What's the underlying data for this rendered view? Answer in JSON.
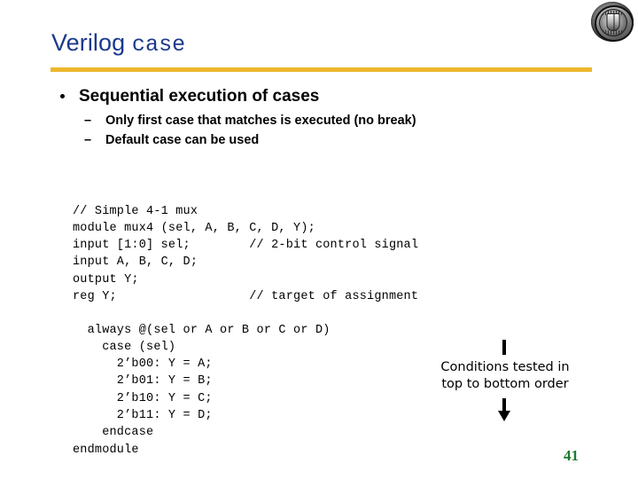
{
  "slide": {
    "title_primary": "Verilog ",
    "title_mono": "case",
    "title_color": "#1b3a8c",
    "rule_color": "#edb72b",
    "page_number": "41",
    "page_number_color": "#1a7a2e",
    "background_color": "#ffffff"
  },
  "logo": {
    "name": "university-seal",
    "description": "circular grayscale university seal"
  },
  "bullets": {
    "level1": [
      {
        "text": "Sequential execution of cases"
      }
    ],
    "level2": [
      {
        "marker": "–",
        "text": "Only first case that matches is executed (no break)"
      },
      {
        "marker": "–",
        "text": "Default case can be used"
      }
    ]
  },
  "code": {
    "top": "// Simple 4-1 mux\nmodule mux4 (sel, A, B, C, D, Y);\ninput [1:0] sel;        // 2-bit control signal\ninput A, B, C, D;\noutput Y;\nreg Y;                  // target of assignment",
    "bottom": "  always @(sel or A or B or C or D)\n    case (sel)\n      2’b00: Y = A;\n      2’b01: Y = B;\n      2’b10: Y = C;\n      2’b11: Y = D;\n    endcase\nendmodule"
  },
  "annotation": {
    "text": "Conditions tested in\ntop to bottom order",
    "has_top_bar": true,
    "has_down_arrow": true
  }
}
